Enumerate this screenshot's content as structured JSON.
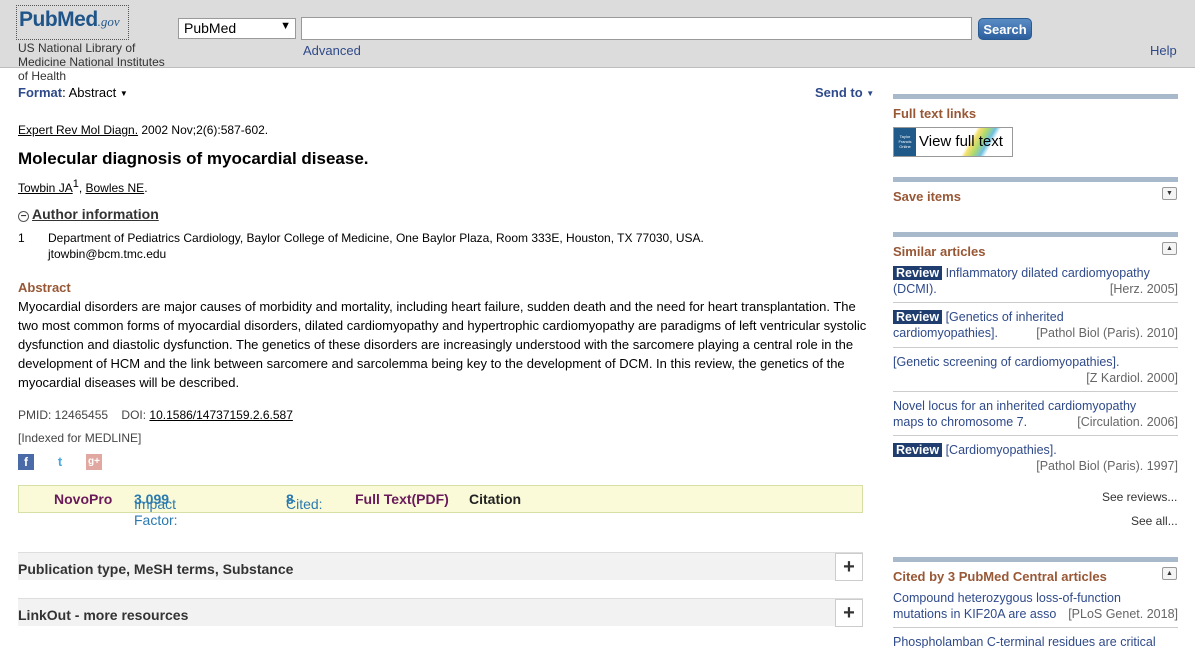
{
  "header": {
    "logo_pub": "Pub",
    "logo_med": "Med",
    "logo_gov": ".gov",
    "nlm_line1": "US National Library of",
    "nlm_line2": "Medicine National Institutes",
    "nlm_line3": "of Health",
    "db_selected": "PubMed",
    "search_value": "",
    "search_button": "Search",
    "advanced": "Advanced",
    "help": "Help"
  },
  "toolbar": {
    "format_label": "Format",
    "format_value": ": Abstract",
    "send_to": "Send to"
  },
  "article": {
    "journal": "Expert Rev Mol Diagn.",
    "citation_rest": " 2002 Nov;2(6):587-602.",
    "title": "Molecular diagnosis of myocardial disease.",
    "author1": "Towbin JA",
    "author1_sup": "1",
    "author_sep": ", ",
    "author2": "Bowles NE",
    "author_end": ".",
    "author_info_label": "Author information",
    "affiliation_num": "1",
    "affiliation_line1": "Department of Pediatrics Cardiology, Baylor College of Medicine, One Baylor Plaza, Room 333E, Houston, TX 77030, USA.",
    "affiliation_line2": "jtowbin@bcm.tmc.edu",
    "abstract_heading": "Abstract",
    "abstract_text": "Myocardial disorders are major causes of morbidity and mortality, including heart failure, sudden death and the need for heart transplantation. The two most common forms of myocardial disorders, dilated cardiomyopathy and hypertrophic cardiomyopathy are paradigms of left ventricular systolic dysfunction and diastolic dysfunction. The genetics of these disorders are increasingly understood with the sarcomere playing a central role in the development of HCM and the link between sarcomere and sarcolemma being key to the development of DCM. In this review, the genetics of the myocardial diseases will be described.",
    "pmid": "PMID: 12465455",
    "doi_label": "DOI: ",
    "doi": "10.1586/14737159.2.6.587",
    "indexed": "[Indexed for MEDLINE]"
  },
  "social": {
    "facebook": "f",
    "twitter": "t",
    "gplus": "g+"
  },
  "novopro": {
    "name": "NovoPro",
    "impact_label": "Impact Factor: ",
    "impact_value": "3.099",
    "cited_label": "Cited: ",
    "cited_value": "8",
    "fulltext": "Full Text(PDF)",
    "citation": "Citation"
  },
  "collapsibles": [
    {
      "label": "Publication type, MeSH terms, Substance",
      "icon": "+"
    },
    {
      "label": "LinkOut - more resources",
      "icon": "+"
    }
  ],
  "sidebar": {
    "fulltext_heading": "Full text links",
    "vft_publisher": "Taylor Francis Online",
    "vft_label": "View full text",
    "save_heading": "Save items",
    "similar_heading": "Similar articles",
    "similar": [
      {
        "badge": "Review",
        "l1": " Inflammatory dilated cardiomyopathy",
        "l2": "(DCMI).",
        "src": "[Herz. 2005]"
      },
      {
        "badge": "Review",
        "l1": " [Genetics of inherited",
        "l2": "cardiomyopathies].",
        "src": "[Pathol Biol (Paris). 2010]"
      },
      {
        "badge": "",
        "l1": "[Genetic screening of cardiomyopathies].",
        "l2": "",
        "src": "[Z Kardiol. 2000]"
      },
      {
        "badge": "",
        "l1": "Novel locus for an inherited cardiomyopathy",
        "l2": "maps to chromosome 7.",
        "src": "[Circulation. 2006]"
      },
      {
        "badge": "Review",
        "l1": " [Cardiomyopathies].",
        "l2": "",
        "src": "[Pathol Biol (Paris). 1997]"
      }
    ],
    "see_reviews": "See reviews...",
    "see_all": "See all...",
    "cited_heading": "Cited by 3 PubMed Central articles",
    "cited": [
      {
        "l1": "Compound heterozygous loss-of-function",
        "l2": "mutations in KIF20A are asso",
        "src": "[PLoS Genet. 2018]"
      },
      {
        "l1": "Phospholamban C-terminal residues are critical",
        "l2": "",
        "src": ""
      }
    ]
  }
}
